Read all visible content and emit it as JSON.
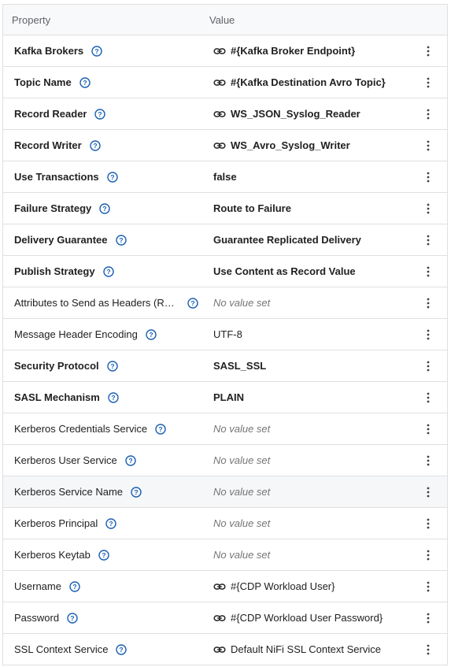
{
  "header": {
    "property": "Property",
    "value": "Value"
  },
  "rows": [
    {
      "label": "Kafka Brokers",
      "value": "#{Kafka Broker Endpoint}",
      "bold": true,
      "link": true,
      "empty": false
    },
    {
      "label": "Topic Name",
      "value": "#{Kafka Destination Avro Topic}",
      "bold": true,
      "link": true,
      "empty": false
    },
    {
      "label": "Record Reader",
      "value": "WS_JSON_Syslog_Reader",
      "bold": true,
      "link": true,
      "empty": false
    },
    {
      "label": "Record Writer",
      "value": "WS_Avro_Syslog_Writer",
      "bold": true,
      "link": true,
      "empty": false
    },
    {
      "label": "Use Transactions",
      "value": "false",
      "bold": true,
      "link": false,
      "empty": false
    },
    {
      "label": "Failure Strategy",
      "value": "Route to Failure",
      "bold": true,
      "link": false,
      "empty": false
    },
    {
      "label": "Delivery Guarantee",
      "value": "Guarantee Replicated Delivery",
      "bold": true,
      "link": false,
      "empty": false
    },
    {
      "label": "Publish Strategy",
      "value": "Use Content as Record Value",
      "bold": true,
      "link": false,
      "empty": false
    },
    {
      "label": "Attributes to Send as Headers (Re…",
      "value": "No value set",
      "bold": false,
      "link": false,
      "empty": true
    },
    {
      "label": "Message Header Encoding",
      "value": "UTF-8",
      "bold": false,
      "link": false,
      "empty": false
    },
    {
      "label": "Security Protocol",
      "value": "SASL_SSL",
      "bold": true,
      "link": false,
      "empty": false
    },
    {
      "label": "SASL Mechanism",
      "value": "PLAIN",
      "bold": true,
      "link": false,
      "empty": false
    },
    {
      "label": "Kerberos Credentials Service",
      "value": "No value set",
      "bold": false,
      "link": false,
      "empty": true
    },
    {
      "label": "Kerberos User Service",
      "value": "No value set",
      "bold": false,
      "link": false,
      "empty": true
    },
    {
      "label": "Kerberos Service Name",
      "value": "No value set",
      "bold": false,
      "link": false,
      "empty": true,
      "highlight": true
    },
    {
      "label": "Kerberos Principal",
      "value": "No value set",
      "bold": false,
      "link": false,
      "empty": true
    },
    {
      "label": "Kerberos Keytab",
      "value": "No value set",
      "bold": false,
      "link": false,
      "empty": true
    },
    {
      "label": "Username",
      "value": "#{CDP Workload User}",
      "bold": false,
      "link": true,
      "empty": false
    },
    {
      "label": "Password",
      "value": "#{CDP Workload User Password}",
      "bold": false,
      "link": true,
      "empty": false
    },
    {
      "label": "SSL Context Service",
      "value": "Default NiFi SSL Context Service",
      "bold": false,
      "link": true,
      "empty": false
    }
  ],
  "icons": {
    "help": "help-circle-icon",
    "link": "link-icon",
    "menu": "more-vertical-icon"
  },
  "colors": {
    "help_blue": "#1a5fb4",
    "border": "#e0e0e0",
    "muted": "#757575"
  }
}
